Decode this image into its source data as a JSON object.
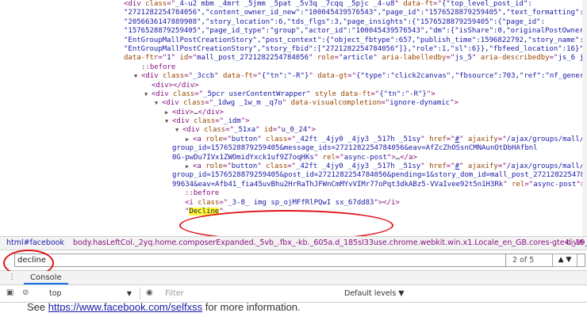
{
  "elements_tree": {
    "lines": [
      {
        "indent": 156,
        "arrow": "",
        "html": "<span class=\"c-tag\">&lt;div</span> <span class=\"c-attr\">class</span>=\"<span class=\"c-val\">_4-u2 mbm _4mrt _5jmm _5pat _5v3q _7cqq _5pjc _4-u8</span>\" <span class=\"c-attr\">data-ft</span>=\"<span class=\"c-val\">{\"top_level_post_id\":</span>"
      },
      {
        "indent": 156,
        "arrow": "",
        "html": "<span class=\"c-val\">\"2721282254784056\",\"content_owner_id_new\":\"100045439576543\",\"page_id\":\"1576528879259405\",\"text_formatting\":</span>"
      },
      {
        "indent": 156,
        "arrow": "",
        "html": "<span class=\"c-val\">\"2056636147889908\",\"story_location\":6,\"tds_flgs\":3,\"page_insights\":{\"1576528879259405\":{\"page_id\":</span>"
      },
      {
        "indent": 156,
        "arrow": "",
        "html": "<span class=\"c-val\">\"1576528879259405\",\"page_id_type\":\"group\",\"actor_id\":\"100045439576543\",\"dm\":{\"isShare\":0,\"originalPostOwnerID\":0},\"p</span>"
      },
      {
        "indent": 156,
        "arrow": "",
        "html": "<span class=\"c-val\">\"EntGroupMallPostCreationStory\",\"post_context\":{\"object_fbtype\":657,\"publish_time\":1596822792,\"story_name\":</span>"
      },
      {
        "indent": 156,
        "arrow": "",
        "html": "<span class=\"c-val\">\"EntGroupMallPostCreationStory\",\"story_fbid\":[\"2721282254784056\"]},\"role\":1,\"sl\":6}},\"fbfeed_location\":16}\"</span> <span class=\"c-attr\">data-</span>"
      },
      {
        "indent": 156,
        "arrow": "",
        "html": "<span class=\"c-attr\">data-ftr</span>=\"<span class=\"c-val\">1</span>\" <span class=\"c-attr\">id</span>=\"<span class=\"c-val\">mall_post_2721282254784056</span>\" <span class=\"c-attr\">role</span>=\"<span class=\"c-val\">article</span>\" <span class=\"c-attr\">aria-labelledby</span>=\"<span class=\"c-val\">js_5</span>\" <span class=\"c-attr\">aria-describedby</span>=\"<span class=\"c-val\">js_6 js_7</span>\"&gt;"
      },
      {
        "indent": 178,
        "arrow": "",
        "html": "<span class=\"c-pseudo\">::before</span>"
      },
      {
        "indent": 178,
        "arrow": "▼",
        "html": "<span class=\"c-tag\">&lt;div</span> <span class=\"c-attr\">class</span>=\"<span class=\"c-val\">_3ccb</span>\" <span class=\"c-attr\">data-ft</span>=\"<span class=\"c-val\">{\"tn\":\"-R\"}</span>\" <span class=\"c-attr\">data-gt</span>=\"<span class=\"c-val\">{\"type\":\"click2canvas\",\"fbsource\":703,\"ref\":\"nf_generic\"}</span>\" <span class=\"c-attr\">id</span>="
      },
      {
        "indent": 191,
        "arrow": "",
        "html": "<span class=\"c-tag\">&lt;div&gt;&lt;/div&gt;</span>"
      },
      {
        "indent": 191,
        "arrow": "▼",
        "html": "<span class=\"c-tag\">&lt;div</span> <span class=\"c-attr\">class</span>=\"<span class=\"c-val\">_5pcr userContentWrapper</span>\" <span class=\"c-attr\">style</span> <span class=\"c-attr\">data-ft</span>=\"<span class=\"c-val\">{\"tn\":\"-R\"}</span>\"&gt;"
      },
      {
        "indent": 204,
        "arrow": "▼",
        "html": "<span class=\"c-tag\">&lt;div</span> <span class=\"c-attr\">class</span>=\"<span class=\"c-val\">_1dwg _1w_m _q7o</span>\" <span class=\"c-attr\">data-visualcompletion</span>=\"<span class=\"c-val\">ignore-dynamic</span>\"&gt;"
      },
      {
        "indent": 217,
        "arrow": "▶",
        "html": "<span class=\"c-tag\">&lt;div&gt;</span><span class=\"c-text\">…</span><span class=\"c-tag\">&lt;/div&gt;</span>"
      },
      {
        "indent": 217,
        "arrow": "▼",
        "html": "<span class=\"c-tag\">&lt;div</span> <span class=\"c-attr\">class</span>=\"<span class=\"c-val\">_idm</span>\"&gt;"
      },
      {
        "indent": 230,
        "arrow": "▼",
        "html": "<span class=\"c-tag\">&lt;div</span> <span class=\"c-attr\">class</span>=\"<span class=\"c-val\">_51xa</span>\" <span class=\"c-attr\">id</span>=\"<span class=\"c-val\">u_0_24</span>\"&gt;"
      },
      {
        "indent": 243,
        "arrow": "▶",
        "html": "<span class=\"c-tag\">&lt;a</span> <span class=\"c-attr\">role</span>=\"<span class=\"c-val\">button</span>\" <span class=\"c-attr\">class</span>=\"<span class=\"c-val\">_42ft _4jy0 _4jy3 _517h _51sy</span>\" <span class=\"c-attr\">href</span>=\"<span class=\"c-link\">#</span>\" <span class=\"c-attr\">ajaxify</span>=\"<span class=\"c-val\">/ajax/groups/mall/approve/?</span>"
      },
      {
        "indent": 217,
        "arrow": "",
        "html": "<span class=\"c-val\">group_id=1576528879259405&amp;message_ids=2721282254784056&amp;eav=AfZcZhOSsnCMNAunOtDbHAfbnl</span>"
      },
      {
        "indent": 217,
        "arrow": "",
        "html": "<span class=\"c-val\">0G-pwDu7IVx1ZWOmidYxck1uf9Z7oqHKs</span>\" <span class=\"c-attr\">rel</span>=\"<span class=\"c-val\">async-post</span>\"&gt;<span class=\"c-text\">…</span><span class=\"c-tag\">&lt;/a&gt;</span>"
      },
      {
        "indent": 243,
        "arrow": "▶",
        "html": "<span class=\"c-tag\">&lt;a</span> <span class=\"c-attr\">role</span>=\"<span class=\"c-val\">button</span>\" <span class=\"c-attr\">class</span>=\"<span class=\"c-val\">_42ft _4jy0 _4jy3 _517h _51sy</span>\" <span class=\"c-attr\">href</span>=\"<span class=\"c-link\">#</span>\" <span class=\"c-attr\">ajaxify</span>=\"<span class=\"c-val\">/ajax/groups/mall/delete/?</span>"
      },
      {
        "indent": 217,
        "arrow": "",
        "html": "<span class=\"c-val\">group_id=1576528879259405&amp;post_id=2721282254784056&amp;pending=1&amp;story_dom_id=mall_post_2721282254784056&amp;av=1</span>"
      },
      {
        "indent": 217,
        "arrow": "",
        "html": "<span class=\"c-val\">99634&amp;eav=Afb41_fia45uvBhu2HrRaThJFWnCmMYvVIMr77oPqt3dkABz5-VVaIvee92t5n1H3Rk</span>\" <span class=\"c-attr\">rel</span>=\"<span class=\"c-val\">async-post</span>\"&gt;"
      },
      {
        "indent": 233,
        "arrow": "",
        "html": "<span class=\"c-pseudo\">::before</span>"
      },
      {
        "indent": 233,
        "arrow": "",
        "html": "<span class=\"c-tag\">&lt;i</span> <span class=\"c-attr\">class</span>=\"<span class=\"c-val\">_3-8_ img sp_ojMFfRlPQwI sx_67dd83</span>\"&gt;<span class=\"c-tag\">&lt;/i&gt;</span>"
      },
      {
        "indent": 233,
        "arrow": "",
        "html": "\"<span class=\"hl-yellow\">Decline</span>\""
      }
    ]
  },
  "breadcrumb": {
    "root": "html#facebook",
    "body": "body.hasLeftCol._2yq.home.composerExpanded._5vb_.fbx_-kb._605a.d_185sl33use.chrome.webkit.win.x1.Locale_en_GB.cores-gte4._19_u.hasAXNavMenubar",
    "div": "div#"
  },
  "search": {
    "value": "decline",
    "count": "2 of 5",
    "up_arrow": "▲",
    "down_arrow": "▼"
  },
  "drawer": {
    "tab_label": "Console"
  },
  "console_toolbar": {
    "context": "top",
    "filter_placeholder": "Filter",
    "levels": "Default levels ▼"
  },
  "console_message": {
    "prefix": "See ",
    "link": "https://www.facebook.com/selfxss",
    "suffix": " for more information."
  },
  "icons": {
    "menu": "menu-icon",
    "sidebar": "sidebar-toggle-icon",
    "clear": "clear-console-icon",
    "eye": "eye-icon"
  }
}
